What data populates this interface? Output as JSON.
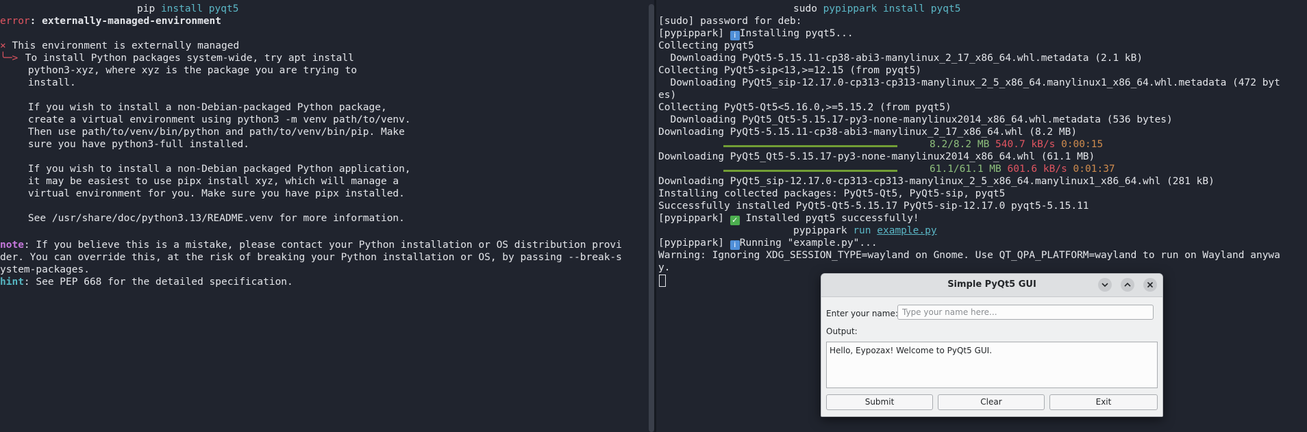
{
  "left_terminal": {
    "cmd_prog": "pip",
    "cmd_args": "install pyqt5",
    "error_prefix": "error",
    "error_msg": ": externally-managed-environment",
    "cross": "×",
    "env_msg": " This environment is externally managed",
    "arrow": "╰─>",
    "lines": [
      " To install Python packages system-wide, try apt install",
      "    python3-xyz, where xyz is the package you are trying to",
      "    install.",
      "",
      "    If you wish to install a non-Debian-packaged Python package,",
      "    create a virtual environment using python3 -m venv path/to/venv.",
      "    Then use path/to/venv/bin/python and path/to/venv/bin/pip. Make",
      "    sure you have python3-full installed.",
      "",
      "    If you wish to install a non-Debian packaged Python application,",
      "    it may be easiest to use pipx install xyz, which will manage a",
      "    virtual environment for you. Make sure you have pipx installed.",
      "",
      "    See /usr/share/doc/python3.13/README.venv for more information."
    ],
    "note_label": "note",
    "note_lines": [
      ": If you believe this is a mistake, please contact your Python installation or OS distribution provi",
      "der. You can override this, at the risk of breaking your Python installation or OS, by passing --break-s",
      "ystem-packages."
    ],
    "hint_label": "hint",
    "hint_text": ": See PEP 668 for the detailed specification."
  },
  "right_terminal": {
    "cmd_prog": "sudo",
    "cmd_args": "pypippark install pyqt5",
    "sudo_prompt": "[sudo] password for deb:",
    "installing_prefix": "[pypippark] ",
    "installing_text": "Installing pyqt5...",
    "lines_a": [
      "Collecting pyqt5",
      "  Downloading PyQt5-5.15.11-cp38-abi3-manylinux_2_17_x86_64.whl.metadata (2.1 kB)",
      "Collecting PyQt5-sip<13,>=12.15 (from pyqt5)",
      "  Downloading PyQt5_sip-12.17.0-cp313-cp313-manylinux_2_5_x86_64.manylinux1_x86_64.whl.metadata (472 byt",
      "es)",
      "Collecting PyQt5-Qt5<5.16.0,>=5.15.2 (from pyqt5)",
      "  Downloading PyQt5_Qt5-5.15.17-py3-none-manylinux2014_x86_64.whl.metadata (536 bytes)",
      "Downloading PyQt5-5.15.11-cp38-abi3-manylinux_2_17_x86_64.whl (8.2 MB)"
    ],
    "progress1": {
      "fraction": 1.0,
      "size": "8.2/8.2 MB",
      "speed": "540.7 kB/s",
      "eta": "0:00:15"
    },
    "download2": "Downloading PyQt5_Qt5-5.15.17-py3-none-manylinux2014_x86_64.whl (61.1 MB)",
    "progress2": {
      "fraction": 1.0,
      "size": "61.1/61.1 MB",
      "speed": "601.6 kB/s",
      "eta": "0:01:37"
    },
    "lines_b": [
      "Downloading PyQt5_sip-12.17.0-cp313-cp313-manylinux_2_5_x86_64.manylinux1_x86_64.whl (281 kB)",
      "Installing collected packages: PyQt5-Qt5, PyQt5-sip, pyqt5",
      "Successfully installed PyQt5-Qt5-5.15.17 PyQt5-sip-12.17.0 pyqt5-5.15.11"
    ],
    "installed_prefix": "[pypippark] ",
    "installed_text": " Installed pyqt5 successfully!",
    "run_prog": "pypippark",
    "run_cmd": "run",
    "run_file": "example.py",
    "running_prefix": "[pypippark] ",
    "running_text": "Running \"example.py\"...",
    "warning_lines": [
      "Warning: Ignoring XDG_SESSION_TYPE=wayland on Gnome. Use QT_QPA_PLATFORM=wayland to run on Wayland anywa",
      "y."
    ]
  },
  "qt_window": {
    "title": "Simple PyQt5 GUI",
    "name_label": "Enter your name:",
    "name_placeholder": "Type your name here...",
    "output_label": "Output:",
    "output_text": "Hello, Eypozax! Welcome to PyQt5 GUI.",
    "buttons": {
      "submit": "Submit",
      "clear": "Clear",
      "exit": "Exit"
    }
  }
}
